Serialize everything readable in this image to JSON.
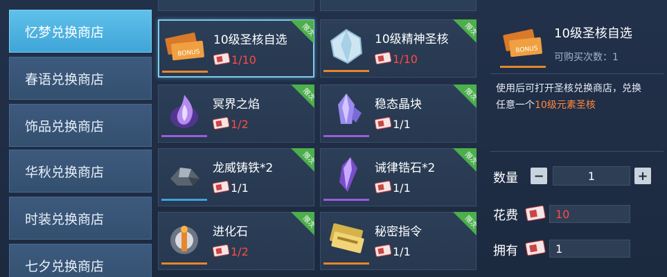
{
  "sidebar": {
    "tabs": [
      {
        "label": "忆梦兑换商店",
        "active": true
      },
      {
        "label": "春语兑换商店",
        "active": false
      },
      {
        "label": "饰品兑换商店",
        "active": false
      },
      {
        "label": "华秋兑换商店",
        "active": false
      },
      {
        "label": "时装兑换商店",
        "active": false
      },
      {
        "label": "七夕兑换商店",
        "active": false
      }
    ]
  },
  "items": [
    {
      "name": "10级圣核自选",
      "count": "1/10",
      "tag": "限次",
      "icon": "bonus-ticket-icon",
      "rarity_color": "#e8862b",
      "count_color": "red"
    },
    {
      "name": "10级精神圣核",
      "count": "1/10",
      "tag": "限次",
      "icon": "crystal-icon",
      "rarity_color": "#e8862b",
      "count_color": "red"
    },
    {
      "name": "冥界之焰",
      "count": "1/2",
      "tag": "限次",
      "icon": "purple-flame-icon",
      "rarity_color": "#9a5ce0",
      "count_color": "red"
    },
    {
      "name": "稳态晶块",
      "count": "1/1",
      "tag": "限次",
      "icon": "violet-crystal-icon",
      "rarity_color": "#9a5ce0",
      "count_color": "white"
    },
    {
      "name": "龙威铸铁*2",
      "count": "1/1",
      "tag": "限次",
      "icon": "iron-ore-icon",
      "rarity_color": "#3fa4d8",
      "count_color": "white"
    },
    {
      "name": "诫律锆石*2",
      "count": "1/1",
      "tag": "限次",
      "icon": "zircon-icon",
      "rarity_color": "#9a5ce0",
      "count_color": "white"
    },
    {
      "name": "进化石",
      "count": "1/2",
      "tag": "限次",
      "icon": "evolution-stone-icon",
      "rarity_color": "#e8862b",
      "count_color": "red"
    },
    {
      "name": "秘密指令",
      "count": "1/1",
      "tag": "限次",
      "icon": "secret-order-icon",
      "rarity_color": "#e8862b",
      "count_color": "white"
    }
  ],
  "detail": {
    "name": "10级圣核自选",
    "limit_label": "可购买次数：1",
    "desc_prefix": "使用后可打开圣核兑换商店，兑换任意一个",
    "desc_highlight": "10级元素圣核",
    "quantity_label": "数量",
    "quantity_value": "1",
    "minus_label": "−",
    "plus_label": "+",
    "cost_label": "花费",
    "cost_value": "10",
    "own_label": "拥有",
    "own_value": "1"
  },
  "colors": {
    "accent": "#5fc1ea",
    "price_red": "#ff4a4a",
    "tag_green": "#4cae4c",
    "highlight": "#ff8a3d"
  }
}
